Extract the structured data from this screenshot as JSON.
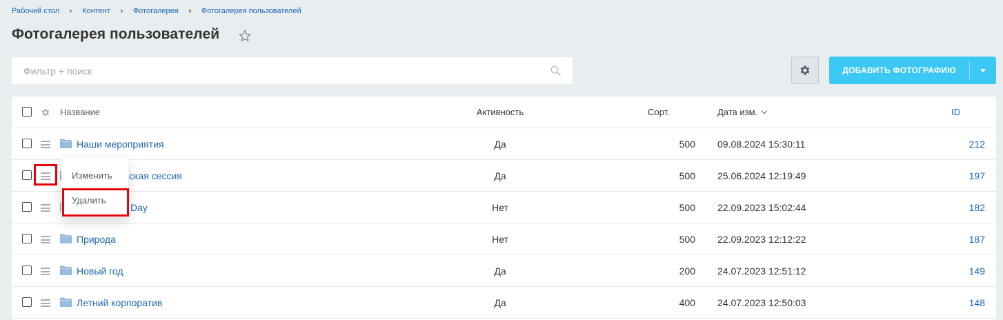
{
  "breadcrumb": [
    "Рабочий стол",
    "Контент",
    "Фотогалерея",
    "Фотогалерея пользователей"
  ],
  "page_title": "Фотогалерея пользователей",
  "filter": {
    "placeholder": "Фильтр + поиск"
  },
  "toolbar": {
    "add_label": "ДОБАВИТЬ ФОТОГРАФИЮ"
  },
  "colors": {
    "accent": "#3bc8f5",
    "link": "#2067b0",
    "highlight": "#e8000b",
    "background": "#e8eef0"
  },
  "table": {
    "headers": {
      "name": "Название",
      "active": "Активность",
      "sort": "Сорт.",
      "date": "Дата изм.",
      "id": "ID"
    },
    "rows": [
      {
        "name": "Наши мероприятия",
        "active": "Да",
        "sort": "500",
        "date": "09.08.2024 15:30:11",
        "id": "212"
      },
      {
        "name": "ская сессия",
        "active": "Да",
        "sort": "500",
        "date": "25.06.2024 12:19:49",
        "id": "197"
      },
      {
        "name": "Day",
        "active": "Нет",
        "sort": "500",
        "date": "22.09.2023 15:02:44",
        "id": "182"
      },
      {
        "name": "Природа",
        "active": "Нет",
        "sort": "500",
        "date": "22.09.2023 12:12:22",
        "id": "187"
      },
      {
        "name": "Новый год",
        "active": "Да",
        "sort": "200",
        "date": "24.07.2023 12:51:12",
        "id": "149"
      },
      {
        "name": "Летний корпоратив",
        "active": "Да",
        "sort": "400",
        "date": "24.07.2023 12:50:03",
        "id": "148"
      }
    ]
  },
  "context_menu": {
    "edit": "Изменить",
    "delete": "Удалить"
  }
}
